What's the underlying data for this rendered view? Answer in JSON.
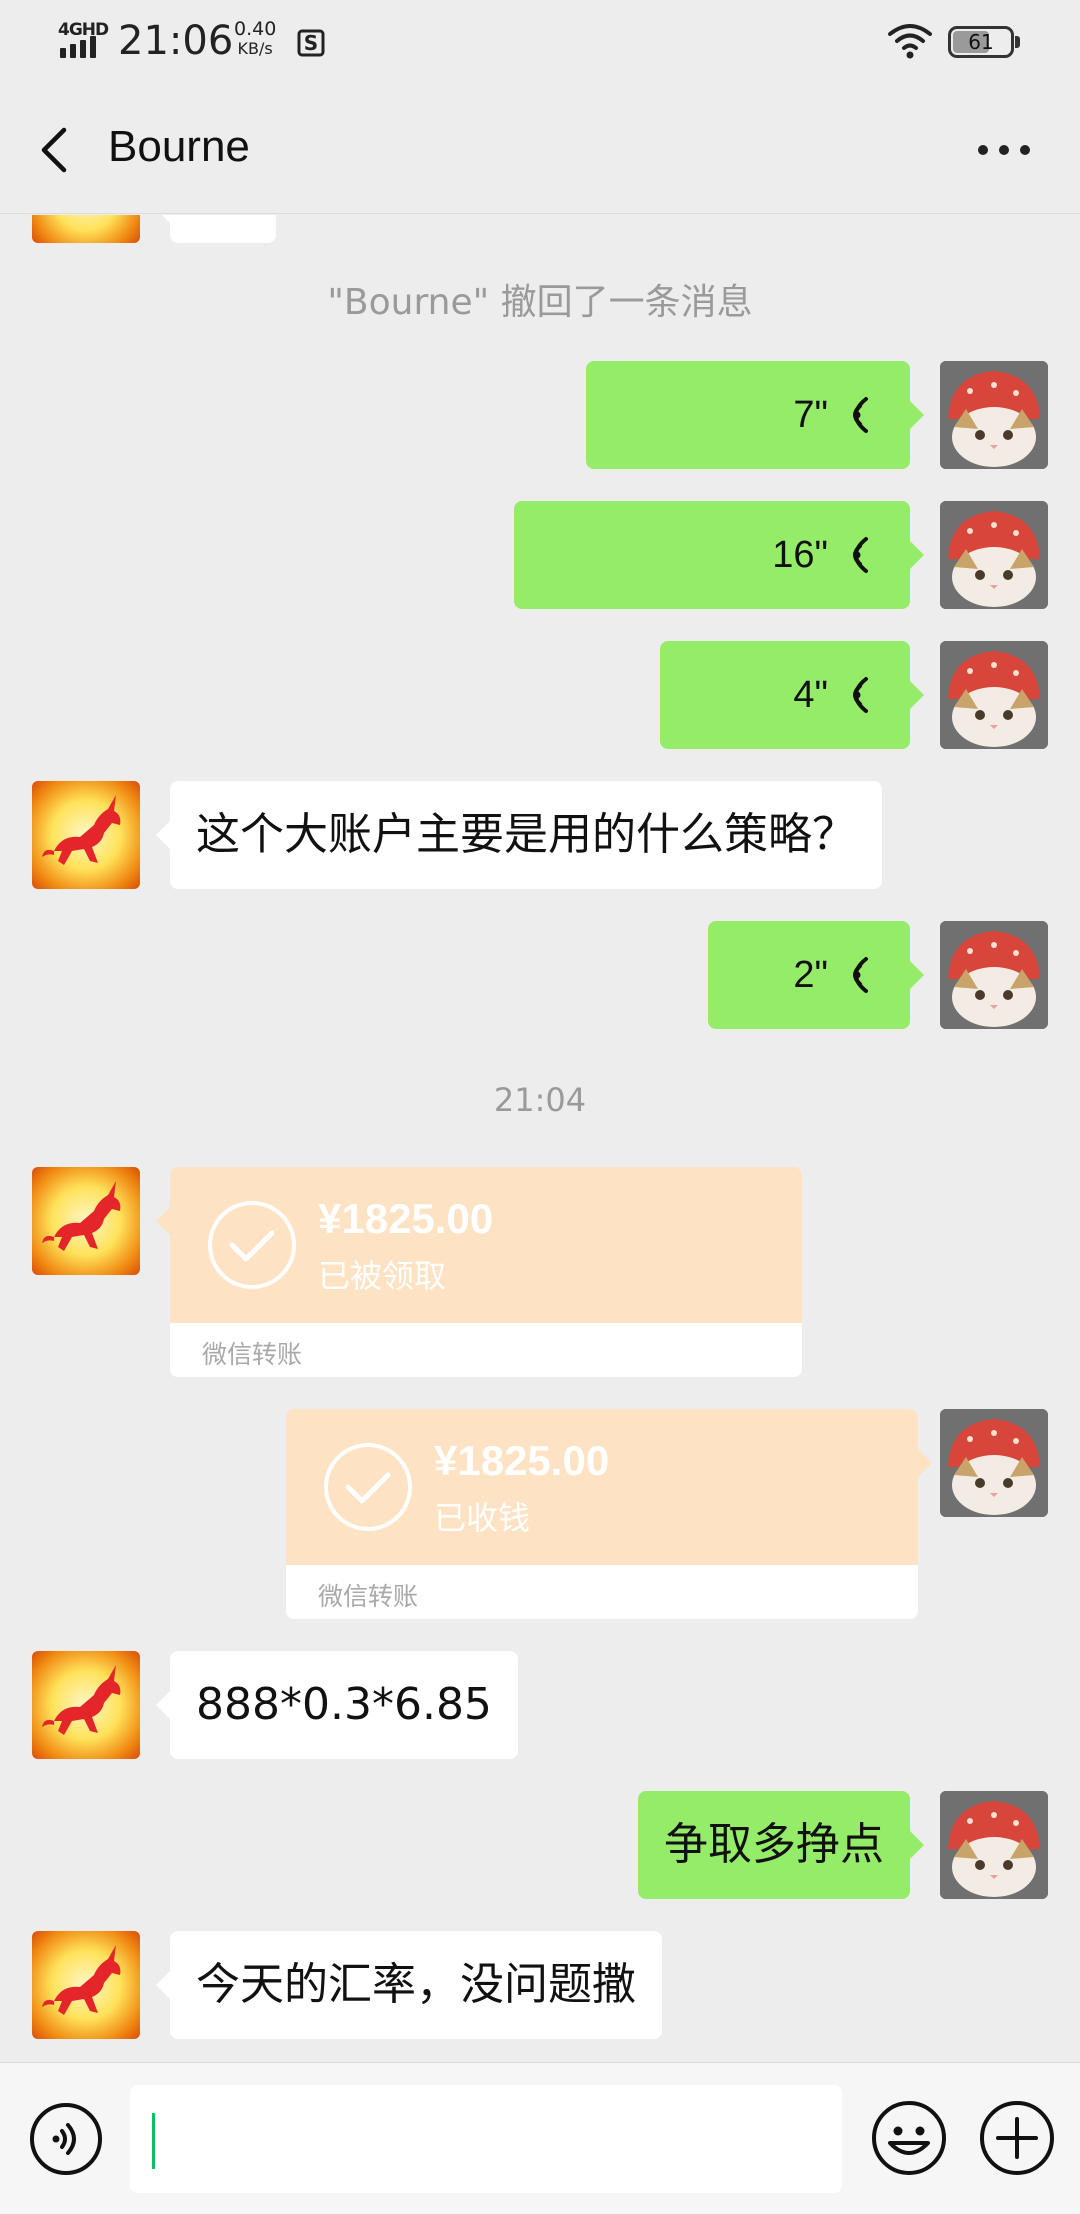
{
  "status_bar": {
    "network": "4GHD",
    "time": "21:06",
    "speed_value": "0.40",
    "speed_unit": "KB/s",
    "battery": "61"
  },
  "header": {
    "title": "Bourne",
    "back_icon": "chevron-left-icon",
    "more_icon": "more-dots-icon"
  },
  "messages": {
    "recall_notice": "\"Bourne\" 撤回了一条消息",
    "voice_1": "7\"",
    "voice_2": "16\"",
    "voice_3": "4\"",
    "text_1": "这个大账户主要是用的什么策略？",
    "voice_4": "2\"",
    "timestamp": "21:04",
    "transfer_received": {
      "amount": "¥1825.00",
      "status": "已被领取",
      "label": "微信转账"
    },
    "transfer_collected": {
      "amount": "¥1825.00",
      "status": "已收钱",
      "label": "微信转账"
    },
    "text_2": "888*0.3*6.85",
    "text_3": "争取多挣点",
    "text_4": "今天的汇率，没问题撒"
  },
  "input_bar": {
    "voice_icon": "voice-input-icon",
    "emoji_icon": "emoji-icon",
    "plus_icon": "plus-icon",
    "value": ""
  },
  "colors": {
    "background": "#ededed",
    "sent_bubble": "#95ec69",
    "received_bubble": "#ffffff",
    "transfer_card": "#fde2c4",
    "caret": "#07c160"
  }
}
